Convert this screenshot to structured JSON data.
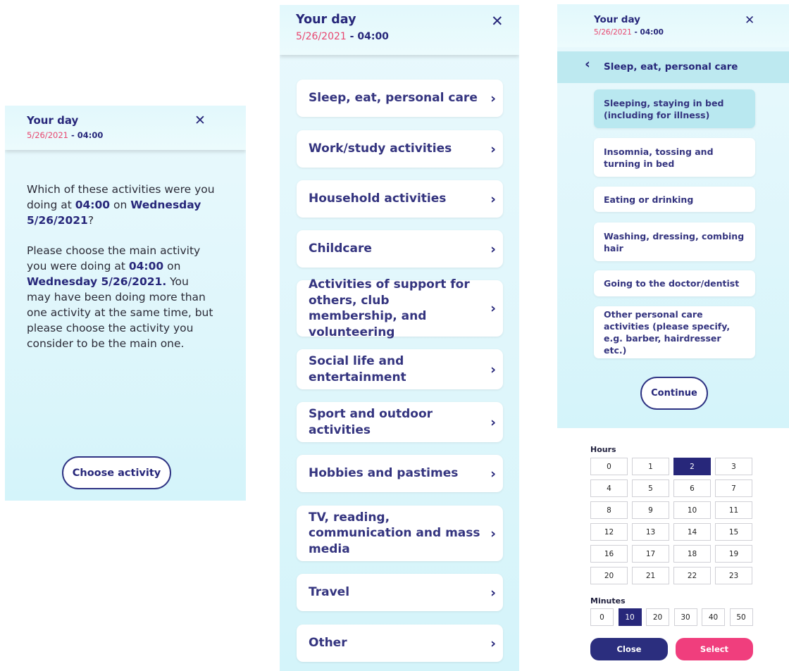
{
  "header": {
    "title": "Your day",
    "date": "5/26/2021",
    "sep": " - ",
    "time": "04:00",
    "close_glyph": "✕"
  },
  "panel1": {
    "q_pre": "Which of these activities were you doing at ",
    "q_time": "04:00",
    "q_mid": " on ",
    "q_day": "Wednesday 5/26/2021",
    "q_end": "?",
    "i_pre": "Please choose the main activity you were doing at ",
    "i_time": "04:00",
    "i_mid": " on ",
    "i_day": "Wednesday 5/26/2021.",
    "i_rest": " You may have been doing more than one activity at the same time, but please choose the activity you consider to be the main one.",
    "button": "Choose activity"
  },
  "panel2": {
    "categories": [
      "Sleep, eat, personal care",
      "Work/study activities",
      "Household activities",
      "Childcare",
      "Activities of support for others, club membership, and volunteering",
      "Social life and entertainment",
      "Sport and outdoor activities",
      "Hobbies and pastimes",
      "TV, reading, communication and mass media",
      "Travel",
      "Other"
    ],
    "chevron": "›"
  },
  "panel3": {
    "back_glyph": "‹",
    "section": "Sleep, eat, personal care",
    "items": [
      "Sleeping, staying in bed (including for illness)",
      "Insomnia, tossing and turning in bed",
      "Eating or drinking",
      "Washing, dressing, combing hair",
      "Going to the doctor/dentist",
      "Other personal care activities (please specify, e.g. barber, hairdresser etc.)"
    ],
    "selected_item": 0,
    "continue": "Continue"
  },
  "picker": {
    "hours_label": "Hours",
    "hours": [
      "0",
      "1",
      "2",
      "3",
      "4",
      "5",
      "6",
      "7",
      "8",
      "9",
      "10",
      "11",
      "12",
      "13",
      "14",
      "15",
      "16",
      "17",
      "18",
      "19",
      "20",
      "21",
      "22",
      "23"
    ],
    "selected_hour": "2",
    "minutes_label": "Minutes",
    "minutes": [
      "0",
      "10",
      "20",
      "30",
      "40",
      "50"
    ],
    "selected_minute": "10",
    "close": "Close",
    "select": "Select",
    "close_color": "#2b2e7e",
    "select_color": "#f03e7d"
  }
}
